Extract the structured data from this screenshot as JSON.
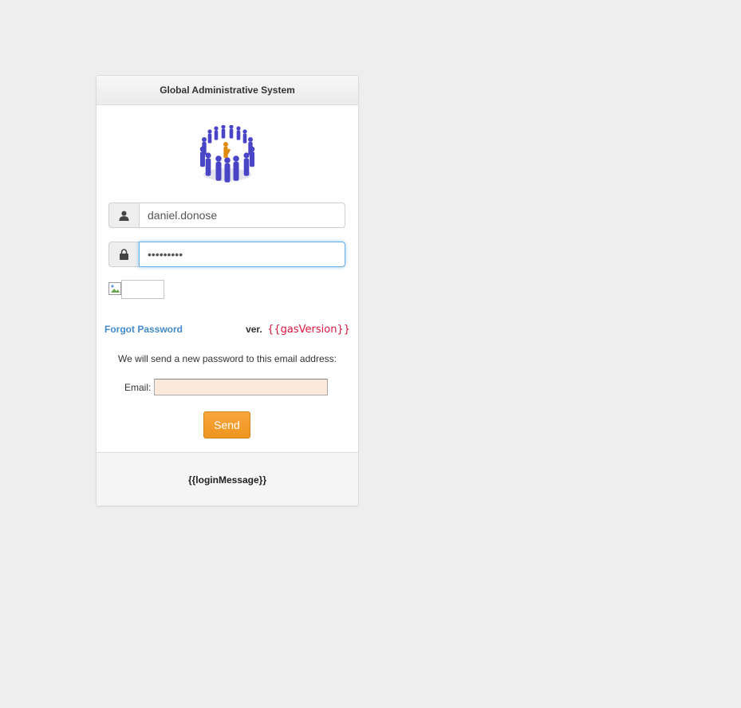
{
  "panel": {
    "title": "Global Administrative System"
  },
  "logo": {
    "icon": "people-circle-logo-icon"
  },
  "username": {
    "icon": "user-icon",
    "value": "daniel.donose"
  },
  "password": {
    "icon": "lock-icon",
    "value": "•••••••••"
  },
  "captcha": {
    "image_icon": "broken-image-icon",
    "value": ""
  },
  "forgot_password": {
    "label": "Forgot Password"
  },
  "version": {
    "prefix": "ver.",
    "value": "{{gasVersion}}"
  },
  "reset": {
    "note": "We will send a new password to this email address:",
    "email_label": "Email:",
    "email_value": "",
    "send_label": "Send"
  },
  "footer": {
    "message": "{{loginMessage}}"
  },
  "colors": {
    "accent_blue": "#428bca",
    "version_red": "#dc143c",
    "send_orange": "#f0a030",
    "email_bg": "#fbeadb"
  }
}
